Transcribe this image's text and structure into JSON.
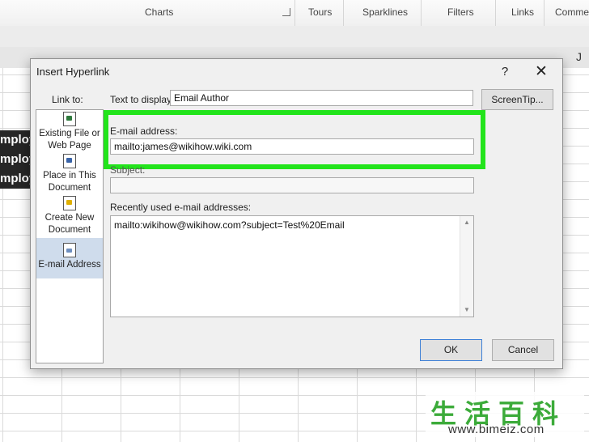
{
  "ribbon": {
    "groups": [
      "Charts",
      "Tours",
      "Sparklines",
      "Filters",
      "Links",
      "Commen"
    ]
  },
  "sheet": {
    "column_j": "J",
    "cells": [
      "mploy",
      "mploy",
      "mploy"
    ]
  },
  "dialog": {
    "title": "Insert Hyperlink",
    "help": "?",
    "close": "✕",
    "link_to_label": "Link to:",
    "link_to_items": [
      {
        "label": "Existing File or Web Page",
        "icon": "existing-file-icon"
      },
      {
        "label": "Place in This Document",
        "icon": "place-in-document-icon"
      },
      {
        "label": "Create New Document",
        "icon": "new-document-icon"
      },
      {
        "label": "E-mail Address",
        "icon": "email-address-icon",
        "selected": true
      }
    ],
    "text_to_display_label": "Text to display:",
    "text_to_display_value": "Email Author",
    "screentip_label": "ScreenTip...",
    "email_label": "E-mail address:",
    "email_value": "mailto:james@wikihow.wiki.com",
    "subject_label": "Subject:",
    "subject_value": "",
    "recent_label": "Recently used e-mail addresses:",
    "recent_items": [
      "mailto:wikihow@wikihow.com?subject=Test%20Email"
    ],
    "ok_label": "OK",
    "cancel_label": "Cancel"
  },
  "watermark": {
    "glyphs": "生活百科",
    "url": "www.bimeiz.com"
  },
  "colors": {
    "highlight": "#22e41b",
    "selected_link": "#cfdcec"
  }
}
